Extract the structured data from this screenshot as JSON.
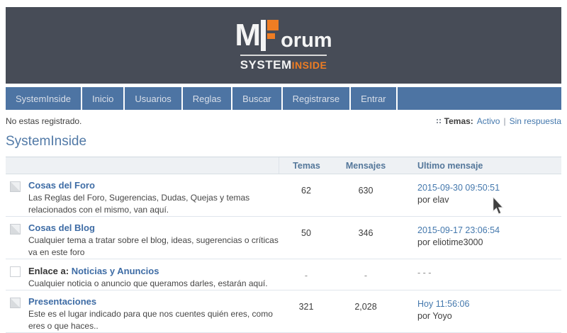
{
  "brand": {
    "logo_m": "M",
    "logo_orum": "orum",
    "logo_system": "SYSTEM",
    "logo_inside": "INSIDE"
  },
  "nav": {
    "items": [
      "SystemInside",
      "Inicio",
      "Usuarios",
      "Reglas",
      "Buscar",
      "Registrarse",
      "Entrar"
    ]
  },
  "statusbar": {
    "left_text": "No estas registrado.",
    "topics_label": "Temas:",
    "link_active": "Activo",
    "separator": "|",
    "link_unanswered": "Sin respuesta"
  },
  "page": {
    "title": "SystemInside"
  },
  "table": {
    "headers": {
      "temas": "Temas",
      "mensajes": "Mensajes",
      "ultimo": "Ultimo mensaje"
    },
    "rows": [
      {
        "icon": "new-posts",
        "title_prefix": "",
        "title": "Cosas del Foro",
        "description": "Las Reglas del Foro, Sugerencias, Dudas, Quejas y temas relacionados con el mismo, van aquí.",
        "temas": "62",
        "mensajes": "630",
        "last_date": "2015-09-30 09:50:51",
        "last_by": "por elav"
      },
      {
        "icon": "new-posts",
        "title_prefix": "",
        "title": "Cosas del Blog",
        "description": "Cualquier tema a tratar sobre el blog, ideas, sugerencias o críticas va en este foro",
        "temas": "50",
        "mensajes": "346",
        "last_date": "2015-09-17 23:06:54",
        "last_by": "por eliotime3000"
      },
      {
        "icon": "link",
        "title_prefix": "Enlace a: ",
        "title": "Noticias y Anuncios",
        "description": "Cualquier noticia o anuncio que queramos darles, estarán aquí.",
        "temas": "-",
        "mensajes": "-",
        "last_date": "- - -",
        "last_by": ""
      },
      {
        "icon": "new-posts",
        "title_prefix": "",
        "title": "Presentaciones",
        "description": "Este es el lugar indicado para que nos cuentes quién eres, como eres o que haces..",
        "temas": "321",
        "mensajes": "2,028",
        "last_date": "Hoy 11:56:06",
        "last_by": "por Yoyo"
      }
    ]
  },
  "colors": {
    "banner_bg": "#474c57",
    "nav_bg": "#4d74a3",
    "accent_orange": "#ef7d23",
    "link_blue": "#3e6ca5",
    "header_band_bg": "#eef1f4"
  }
}
